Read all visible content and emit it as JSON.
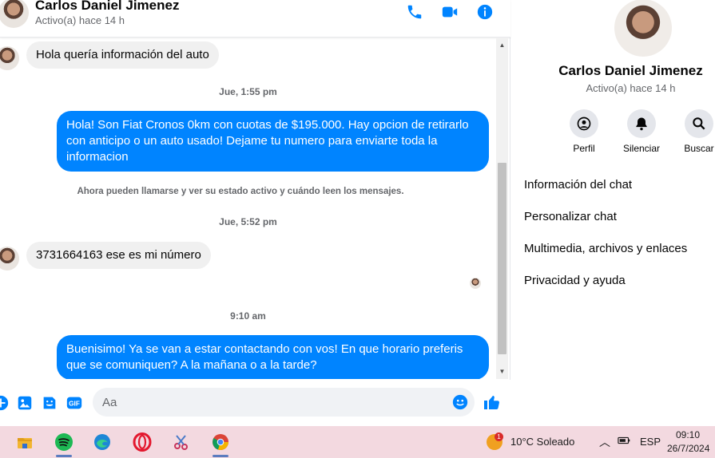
{
  "header": {
    "name": "Carlos Daniel Jimenez",
    "status": "Activo(a) hace 14 h",
    "actions": [
      "phone-icon",
      "video-camera-icon",
      "info-icon"
    ]
  },
  "messages": {
    "msg1": "Hola quería información del auto",
    "ts1": "Jue, 1:55 pm",
    "msg2": "Hola! Son Fiat Cronos 0km con cuotas de $195.000. Hay opcion de retirarlo con anticipo o un auto usado! Dejame tu numero para enviarte toda la informacion",
    "notice": "Ahora pueden llamarse y ver su estado activo y cuándo leen los mensajes.",
    "ts2": "Jue, 5:52 pm",
    "msg3": "3731664163 ese es mi número",
    "ts3": "9:10 am",
    "msg4": "Buenisimo! Ya se van a estar contactando con vos! En que horario preferis que se comuniquen? A la mañana o a la tarde?"
  },
  "composer": {
    "placeholder": "Aa",
    "icons": [
      "plus-icon",
      "image-icon",
      "sticker-icon",
      "gif-icon",
      "emoji-icon",
      "like-icon"
    ],
    "gif_label": "GIF"
  },
  "info": {
    "name": "Carlos Daniel Jimenez",
    "status": "Activo(a) hace 14 h",
    "actions": [
      {
        "label": "Perfil",
        "icon": "profile-icon"
      },
      {
        "label": "Silenciar",
        "icon": "bell-icon"
      },
      {
        "label": "Buscar",
        "icon": "search-icon"
      }
    ],
    "menu": [
      "Información del chat",
      "Personalizar chat",
      "Multimedia, archivos y enlaces",
      "Privacidad y ayuda"
    ]
  },
  "taskbar": {
    "apps": [
      "file-explorer-icon",
      "spotify-icon",
      "edge-icon",
      "opera-icon",
      "snipping-tool-icon",
      "chrome-icon"
    ],
    "weather_badge": "1",
    "weather": "10°C  Soleado",
    "language": "ESP",
    "time": "09:10",
    "date": "26/7/2024"
  },
  "colors": {
    "accent": "#0084ff",
    "incoming_bubble": "#f0f0f0",
    "taskbar": "#f3d9e0"
  }
}
